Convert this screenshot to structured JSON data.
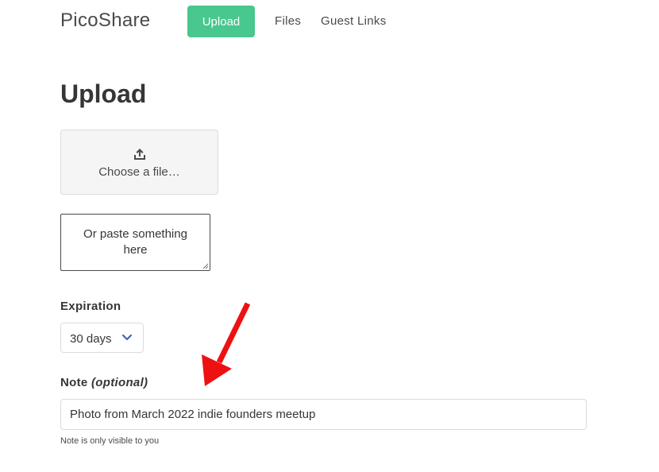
{
  "navbar": {
    "brand": "PicoShare",
    "upload_label": "Upload",
    "files_label": "Files",
    "guest_links_label": "Guest Links"
  },
  "main": {
    "title": "Upload",
    "file_picker": {
      "label": "Choose a file…",
      "icon": "upload-icon"
    },
    "paste_placeholder": "Or paste something here",
    "expiration": {
      "label": "Expiration",
      "selected": "30 days"
    },
    "note": {
      "label": "Note",
      "label_suffix": "(optional)",
      "value": "Photo from March 2022 indie founders meetup",
      "help": "Note is only visible to you"
    }
  },
  "colors": {
    "accent": "#48c78e",
    "annotation_arrow": "#ee1111",
    "select_chevron": "#485fc7"
  }
}
